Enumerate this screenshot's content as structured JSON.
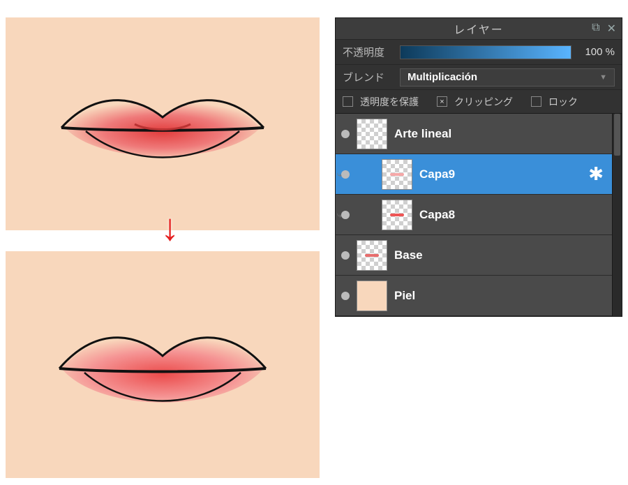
{
  "arrow_glyph": "↓",
  "panel": {
    "title": "レイヤー",
    "popout_glyph": "⧉",
    "close_glyph": "✕",
    "opacity": {
      "label": "不透明度",
      "value_text": "100 %",
      "percent": 100
    },
    "blend": {
      "label": "ブレンド",
      "mode": "Multiplicación"
    },
    "options": {
      "preserve_opacity": {
        "label": "透明度を保護",
        "checked": false
      },
      "clipping": {
        "label": "クリッピング",
        "checked": true
      },
      "lock": {
        "label": "ロック",
        "checked": false
      }
    }
  },
  "layers": [
    {
      "name": "Arte lineal",
      "indent": false,
      "selected": false,
      "thumb": "checker",
      "mark": null,
      "gear": false,
      "clip": false
    },
    {
      "name": "Capa9",
      "indent": true,
      "selected": true,
      "thumb": "checker",
      "mark": "#f5a8a8",
      "gear": true,
      "clip": true
    },
    {
      "name": "Capa8",
      "indent": true,
      "selected": false,
      "thumb": "checker",
      "mark": "#e55",
      "gear": false,
      "clip": true
    },
    {
      "name": "Base",
      "indent": false,
      "selected": false,
      "thumb": "checker",
      "mark": "#e76d6d",
      "gear": false,
      "clip": false
    },
    {
      "name": "Piel",
      "indent": false,
      "selected": false,
      "thumb": "skin",
      "mark": null,
      "gear": false,
      "clip": false
    }
  ],
  "colors": {
    "skin": "#f8d7bc",
    "accent": "#3a8fd9",
    "arrow": "#e51f1f"
  }
}
